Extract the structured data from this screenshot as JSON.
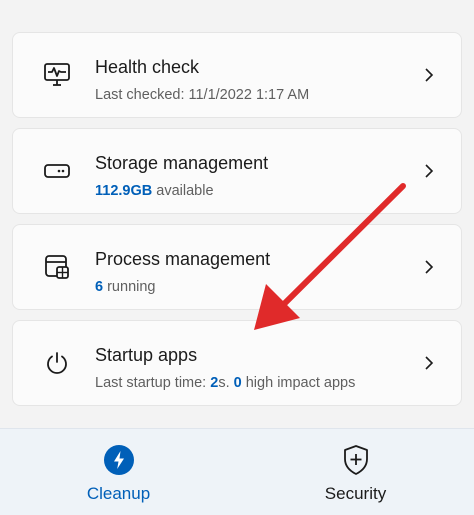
{
  "cards": [
    {
      "title": "Health check",
      "subtitle_prefix": "Last checked: 11/1/2022 1:17 AM",
      "icon": "health-monitor-icon"
    },
    {
      "title": "Storage management",
      "value": "112.9GB",
      "subtitle_suffix": " available",
      "icon": "storage-drive-icon"
    },
    {
      "title": "Process management",
      "value": "6",
      "subtitle_suffix": " running",
      "icon": "process-window-icon"
    },
    {
      "title": "Startup apps",
      "subtitle_prefix": "Last startup time: ",
      "value1": "2",
      "subtitle_mid": "s. ",
      "value2": "0",
      "subtitle_suffix": " high impact apps",
      "icon": "power-icon"
    }
  ],
  "nav": {
    "cleanup_label": "Cleanup",
    "security_label": "Security"
  },
  "colors": {
    "accent": "#005fb8",
    "arrow": "#e02a2a"
  }
}
